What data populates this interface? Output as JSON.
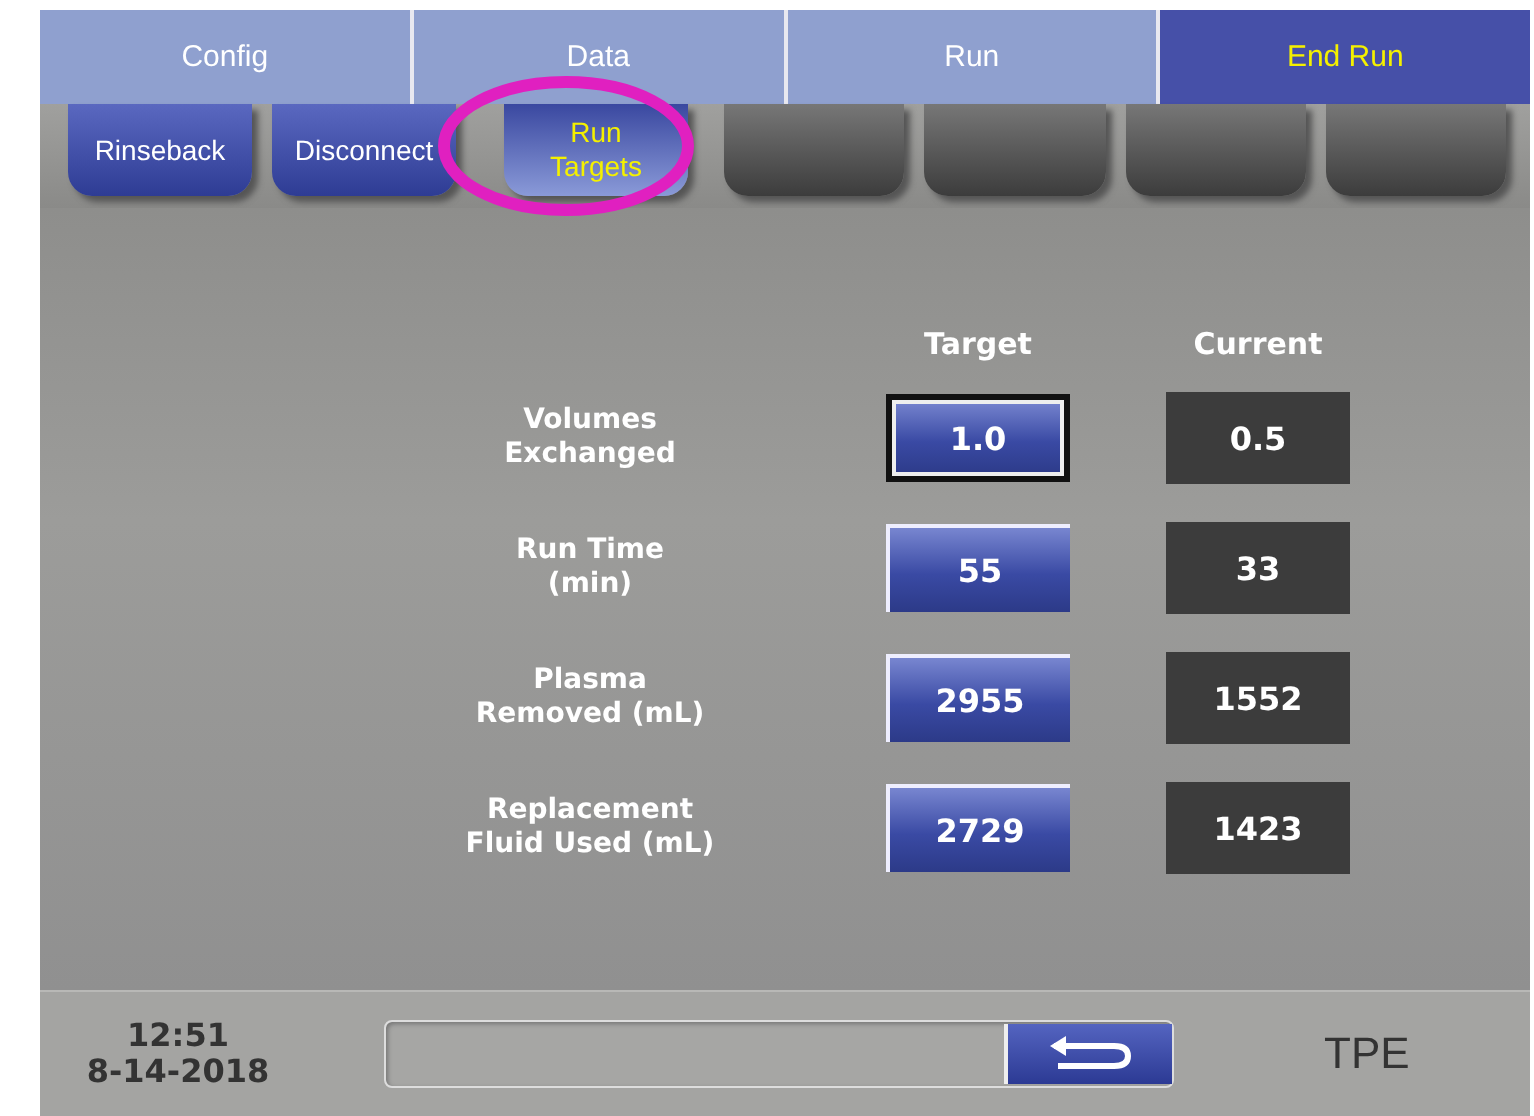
{
  "tabs": [
    {
      "label": "Config",
      "selected": false
    },
    {
      "label": "Data",
      "selected": false
    },
    {
      "label": "Run",
      "selected": false
    },
    {
      "label": "End Run",
      "selected": true
    }
  ],
  "subtabs": [
    {
      "kind": "button",
      "label": "Rinseback",
      "selected": false
    },
    {
      "kind": "button",
      "label": "Disconnect",
      "selected": false
    },
    {
      "kind": "button",
      "label": "Run\nTargets",
      "selected": true
    },
    {
      "kind": "blank"
    },
    {
      "kind": "blank"
    },
    {
      "kind": "blank"
    },
    {
      "kind": "blank"
    }
  ],
  "highlight": {
    "kind": "ellipse",
    "color": "#e020c0"
  },
  "table": {
    "columns": [
      "Target",
      "Current"
    ],
    "rows": [
      {
        "label": "Volumes\nExchanged",
        "target": "1.0",
        "current": "0.5",
        "selected": true
      },
      {
        "label": "Run Time\n(min)",
        "target": "55",
        "current": "33",
        "selected": false
      },
      {
        "label": "Plasma\nRemoved (mL)",
        "target": "2955",
        "current": "1552",
        "selected": false
      },
      {
        "label": "Replacement\nFluid Used (mL)",
        "target": "2729",
        "current": "1423",
        "selected": false
      }
    ]
  },
  "status_bar": {
    "time": "12:51",
    "date": "8-14-2018",
    "mode": "TPE"
  }
}
